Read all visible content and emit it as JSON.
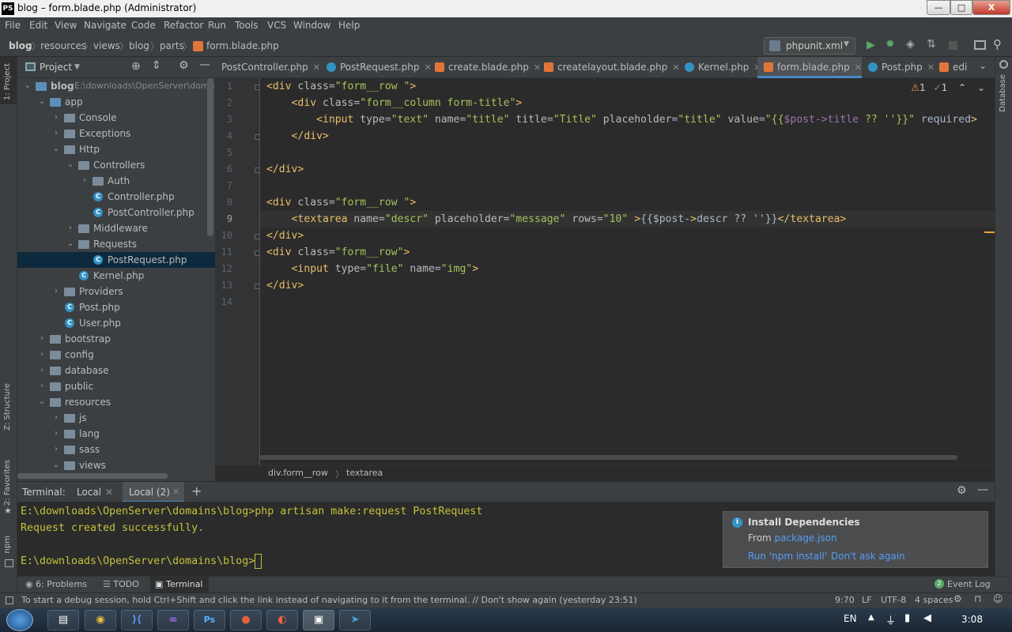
{
  "window": {
    "title": "blog – form.blade.php (Administrator)",
    "app_badge": "PS",
    "min": "—",
    "max": "□",
    "close": "X"
  },
  "menu": [
    "File",
    "Edit",
    "View",
    "Navigate",
    "Code",
    "Refactor",
    "Run",
    "Tools",
    "VCS",
    "Window",
    "Help"
  ],
  "breadcrumb": [
    "blog",
    "resources",
    "views",
    "blog",
    "parts",
    "form.blade.php"
  ],
  "run_config": {
    "label": "phpunit.xml"
  },
  "left_strip": {
    "project": "1: Project",
    "structure": "Z: Structure",
    "favorites": "2: Favorites",
    "npm": "npm"
  },
  "right_strip": {
    "database": "Database"
  },
  "project_panel": {
    "title": "Project",
    "tree": [
      {
        "label": "blog",
        "extra": "E:\\downloads\\OpenServer\\domains\\blog",
        "depth": 0,
        "type": "folder",
        "open": true
      },
      {
        "label": "app",
        "depth": 1,
        "type": "folder",
        "open": true
      },
      {
        "label": "Console",
        "depth": 2,
        "type": "folder",
        "open": false
      },
      {
        "label": "Exceptions",
        "depth": 2,
        "type": "folder",
        "open": false
      },
      {
        "label": "Http",
        "depth": 2,
        "type": "folder",
        "open": true
      },
      {
        "label": "Controllers",
        "depth": 3,
        "type": "folder",
        "open": true
      },
      {
        "label": "Auth",
        "depth": 4,
        "type": "folder",
        "open": false
      },
      {
        "label": "Controller.php",
        "depth": 4,
        "type": "php"
      },
      {
        "label": "PostController.php",
        "depth": 4,
        "type": "php"
      },
      {
        "label": "Middleware",
        "depth": 3,
        "type": "folder",
        "open": false
      },
      {
        "label": "Requests",
        "depth": 3,
        "type": "folder",
        "open": true
      },
      {
        "label": "PostRequest.php",
        "depth": 4,
        "type": "php",
        "selected": true
      },
      {
        "label": "Kernel.php",
        "depth": 3,
        "type": "php"
      },
      {
        "label": "Providers",
        "depth": 2,
        "type": "folder",
        "open": false
      },
      {
        "label": "Post.php",
        "depth": 2,
        "type": "php"
      },
      {
        "label": "User.php",
        "depth": 2,
        "type": "php"
      },
      {
        "label": "bootstrap",
        "depth": 1,
        "type": "folder",
        "open": false
      },
      {
        "label": "config",
        "depth": 1,
        "type": "folder",
        "open": false
      },
      {
        "label": "database",
        "depth": 1,
        "type": "folder",
        "open": false
      },
      {
        "label": "public",
        "depth": 1,
        "type": "folder",
        "open": false
      },
      {
        "label": "resources",
        "depth": 1,
        "type": "folder",
        "open": true
      },
      {
        "label": "js",
        "depth": 2,
        "type": "folder",
        "open": false
      },
      {
        "label": "lang",
        "depth": 2,
        "type": "folder",
        "open": false
      },
      {
        "label": "sass",
        "depth": 2,
        "type": "folder",
        "open": false
      },
      {
        "label": "views",
        "depth": 2,
        "type": "folder",
        "open": true
      }
    ]
  },
  "tabs": [
    {
      "label": "PostController.php",
      "kind": "php"
    },
    {
      "label": "PostRequest.php",
      "kind": "php"
    },
    {
      "label": "create.blade.php",
      "kind": "html"
    },
    {
      "label": "createlayout.blade.php",
      "kind": "html"
    },
    {
      "label": "Kernel.php",
      "kind": "php"
    },
    {
      "label": "form.blade.php",
      "kind": "html",
      "active": true
    },
    {
      "label": "Post.php",
      "kind": "php"
    },
    {
      "label": "edi",
      "kind": "html"
    }
  ],
  "inspections": {
    "warnings": "1",
    "weak": "1"
  },
  "editor": {
    "line_numbers": [
      "1",
      "2",
      "3",
      "4",
      "5",
      "6",
      "7",
      "8",
      "9",
      "10",
      "11",
      "12",
      "13",
      "14"
    ],
    "current_line": 9,
    "lines": [
      "<div class=\"form__row \">",
      "    <div class=\"form__column form-title\">",
      "        <input type=\"text\" name=\"title\" title=\"Title\" placeholder=\"title\" value=\"{{$post->title ?? ''}}\" required>",
      "    </div>",
      "",
      "</div>",
      "",
      "<div class=\"form__row \">",
      "    <textarea name=\"descr\" placeholder=\"message\" rows=\"10\" >{{$post->descr ?? ''}}</textarea>",
      "</div>",
      "<div class=\"form__row\">",
      "    <input type=\"file\" name=\"img\">",
      "</div>",
      ""
    ],
    "breadcrumb": [
      "div.form__row",
      "textarea"
    ]
  },
  "terminal": {
    "label": "Terminal:",
    "tabs": [
      "Local",
      "Local (2)"
    ],
    "lines": [
      "E:\\downloads\\OpenServer\\domains\\blog>php artisan make:request PostRequest",
      "Request created successfully.",
      "",
      "E:\\downloads\\OpenServer\\domains\\blog>"
    ]
  },
  "notification": {
    "title": "Install Dependencies",
    "body_prefix": "From ",
    "body_link": "package.json",
    "action1": "Run 'npm install'",
    "action2": "Don't ask again"
  },
  "bottom_tabs": {
    "problems": "6: Problems",
    "todo": "TODO",
    "terminal": "Terminal",
    "event_log": "Event Log",
    "event_count": "2"
  },
  "status": {
    "message": "To start a debug session, hold Ctrl+Shift and click the link instead of navigating to it from the terminal. // Don't show again (yesterday 23:51)",
    "position": "9:70",
    "line_sep": "LF",
    "encoding": "UTF-8",
    "indent": "4 spaces"
  },
  "taskbar": {
    "lang": "EN",
    "time": "3:08",
    "ps_label": "Ps"
  },
  "colors": {
    "accent": "#4a88c7",
    "tag": "#e8bf6a",
    "string": "#a5c25c",
    "variable": "#9876aa",
    "terminal_text": "#c0c33c"
  }
}
